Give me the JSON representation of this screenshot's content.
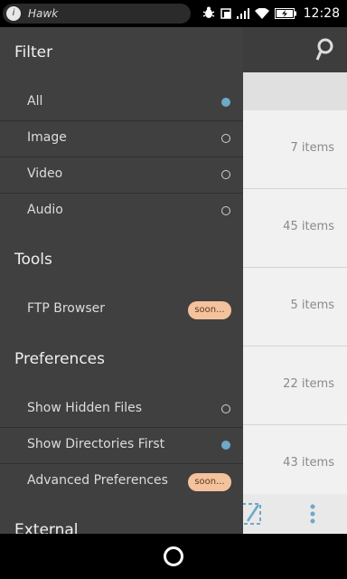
{
  "status": {
    "app_name": "Hawk",
    "time": "12:28"
  },
  "background": {
    "item_counts": [
      "7 items",
      "45 items",
      "5 items",
      "22 items",
      "43 items"
    ]
  },
  "drawer": {
    "filter": {
      "title": "Filter",
      "items": [
        {
          "label": "All",
          "selected": true
        },
        {
          "label": "Image",
          "selected": false
        },
        {
          "label": "Video",
          "selected": false
        },
        {
          "label": "Audio",
          "selected": false
        }
      ]
    },
    "tools": {
      "title": "Tools",
      "items": [
        {
          "label": "FTP Browser",
          "badge": "soon..."
        }
      ]
    },
    "preferences": {
      "title": "Preferences",
      "items": [
        {
          "label": "Show Hidden Files",
          "selected": false
        },
        {
          "label": "Show Directories First",
          "selected": true
        },
        {
          "label": "Advanced Preferences",
          "badge": "soon..."
        }
      ]
    },
    "external": {
      "title": "External"
    }
  },
  "colors": {
    "drawer_bg": "#404040",
    "accent": "#6fa8c8",
    "badge_bg": "#f4c29c"
  }
}
